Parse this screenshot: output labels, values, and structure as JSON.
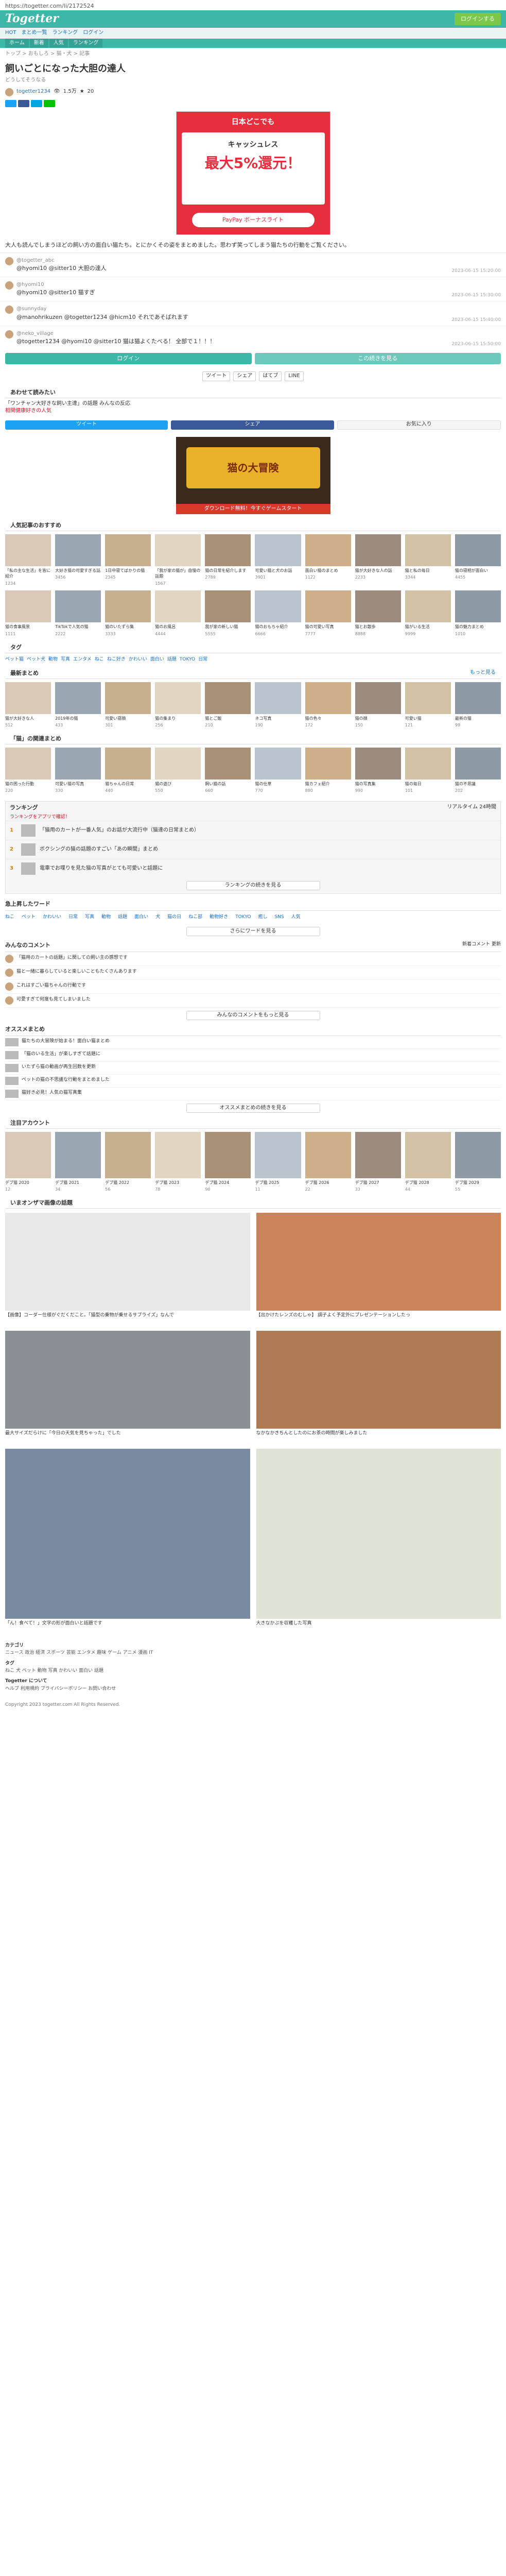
{
  "url": "https://togetter.com/li/2172524",
  "header": {
    "logo": "Togetter",
    "cta": "ログインする",
    "subnav": [
      "HOT",
      "まとめ一覧",
      "ランキング",
      "ログイン"
    ],
    "gnav": [
      "ホーム",
      "新着",
      "人気",
      "ランキング"
    ]
  },
  "breadcrumb": "トップ > おもしろ > 猫・犬 > 記事",
  "title": "飼いごとになった大胆の達人",
  "subtitle": "どうしてそうなる",
  "author": {
    "name": "togetter1234",
    "views": "1.5万",
    "favorites": "20"
  },
  "ad1": {
    "top": "日本どこでも",
    "mid": "キャッシュレス",
    "big": "最大5%還元！",
    "btn": "PayPay ボーナスライト"
  },
  "intro": "大人も読んでしまうほどの飼い方の面白い猫たち。とにかくその姿をまとめました。思わず笑ってしまう猫たちの行動をご覧ください。",
  "tweets": [
    {
      "user": "@togetter_abc",
      "text": "@hyomi10 @sitter10 大胆の達人",
      "time": "2023-06-15 15:20:00"
    },
    {
      "user": "@hyomi10",
      "text": "@hyomi10 @sitter10 猫すぎ",
      "time": "2023-06-15 15:30:00"
    },
    {
      "user": "@sunnyday",
      "text": "@manohrikuzen @togetter1234 @hicm10 それであそばれます",
      "time": "2023-06-15 15:40:00"
    },
    {
      "user": "@neko_village",
      "text": "@togetter1234 @hyomi10 @sitter10 猫は猫よくたべる！ 全部で１！！！",
      "time": "2023-06-15 15:50:00"
    }
  ],
  "pager": {
    "prev": "ログイン",
    "next": "この続きを見る"
  },
  "share": [
    "ツイート",
    "シェア",
    "はてブ",
    "LINE"
  ],
  "related": {
    "heading": "あわせて読みたい",
    "line1": "「ワンチャン大好きな飼い主達」の話題 みんなの反応",
    "line2": "相関健康好きの人気",
    "buttons": [
      "ツイート",
      "シェア",
      "お気に入り"
    ]
  },
  "ad2": {
    "text": "猫の大冒険",
    "bar": "ダウンロード無料！今すぐゲームスタート"
  },
  "section1": {
    "heading": "人気記事のおすすめ",
    "cards": [
      {
        "t": "「私の主な生活」を皆に紹介",
        "m": "1234"
      },
      {
        "t": "大好き猫の可愛すぎる話",
        "m": "3456"
      },
      {
        "t": "1日中寝てばかりの猫",
        "m": "2345"
      },
      {
        "t": "「我が家の猫が」自慢の話題",
        "m": "1567"
      },
      {
        "t": "猫の日常を紹介します",
        "m": "2789"
      },
      {
        "t": "可愛い猫と犬のお話",
        "m": "3901"
      },
      {
        "t": "面白い猫のまとめ",
        "m": "1122"
      },
      {
        "t": "猫が大好きな人の話",
        "m": "2233"
      },
      {
        "t": "猫と私の毎日",
        "m": "3344"
      },
      {
        "t": "猫の寝相が面白い",
        "m": "4455"
      },
      {
        "t": "猫の食事風景",
        "m": "1111"
      },
      {
        "t": "TikTokで人気の猫",
        "m": "2222"
      },
      {
        "t": "猫のいたずら集",
        "m": "3333"
      },
      {
        "t": "猫のお風呂",
        "m": "4444"
      },
      {
        "t": "我が家の新しい猫",
        "m": "5555"
      },
      {
        "t": "猫のおもちゃ紹介",
        "m": "6666"
      },
      {
        "t": "猫の可愛い写真",
        "m": "7777"
      },
      {
        "t": "猫とお散歩",
        "m": "8888"
      },
      {
        "t": "猫がいる生活",
        "m": "9999"
      },
      {
        "t": "猫の魅力まとめ",
        "m": "1010"
      }
    ]
  },
  "tags": [
    "ペット猫",
    "ペット犬",
    "動物",
    "写真",
    "エンタメ",
    "ねこ",
    "ねこ好き",
    "かわいい",
    "面白い",
    "話題",
    "TOKYO",
    "日常"
  ],
  "section2": {
    "heading": "最新まとめ",
    "more": "もっと見る",
    "cards": [
      {
        "t": "猫が大好きな人",
        "m": "512"
      },
      {
        "t": "2019年の猫",
        "m": "433"
      },
      {
        "t": "可愛い寝顔",
        "m": "301"
      },
      {
        "t": "猫の集まり",
        "m": "256"
      },
      {
        "t": "猫とご飯",
        "m": "210"
      },
      {
        "t": "ネコ写真",
        "m": "190"
      },
      {
        "t": "猫の色々",
        "m": "172"
      },
      {
        "t": "猫の顔",
        "m": "150"
      },
      {
        "t": "可愛い猫",
        "m": "121"
      },
      {
        "t": "最新の猫",
        "m": "99"
      }
    ]
  },
  "section3": {
    "heading": "「猫」の関連まとめ",
    "cards": [
      {
        "t": "猫の困った行動",
        "m": "220"
      },
      {
        "t": "可愛い猫の写真",
        "m": "330"
      },
      {
        "t": "猫ちゃんの日常",
        "m": "440"
      },
      {
        "t": "猫の遊び",
        "m": "550"
      },
      {
        "t": "飼い猫の話",
        "m": "660"
      },
      {
        "t": "猫の仕草",
        "m": "770"
      },
      {
        "t": "猫カフェ紹介",
        "m": "880"
      },
      {
        "t": "猫の写真集",
        "m": "990"
      },
      {
        "t": "猫の毎日",
        "m": "101"
      },
      {
        "t": "猫の不思議",
        "m": "202"
      }
    ]
  },
  "ranking": {
    "heading": "ランキング",
    "tabs": "リアルタイム  24時間",
    "sub": "ランキングをアプリで確認！",
    "items": [
      {
        "n": "1",
        "t": "「猫用のカートが一番人気」のお話が大流行中（猫達の日常まとめ）"
      },
      {
        "n": "2",
        "t": "ボクシングの猫の話題のすごい「あの瞬間」まとめ"
      },
      {
        "n": "3",
        "t": "電車でお喋りを見た猫の写真がとても可愛いと話題に"
      }
    ],
    "more": "ランキングの続きを見る"
  },
  "keywords": {
    "heading": "急上昇したワード",
    "list": [
      "ねこ",
      "ペット",
      "かわいい",
      "日常",
      "写真",
      "動物",
      "話題",
      "面白い",
      "犬",
      "猫の日",
      "ねこ部",
      "動物好き",
      "TOKYO",
      "癒し",
      "SNS",
      "人気"
    ],
    "more": "さらにワードを見る"
  },
  "comments": {
    "heading": "みんなのコメント",
    "tabs": "新着コメント  更新",
    "items": [
      "「猫用のカートの話題」に関しての飼い主の感想です",
      "猫と一緒に暮らしていると楽しいこともたくさんあります",
      "これはすごい猫ちゃんの行動です",
      "可愛すぎて何度も見てしまいました"
    ],
    "more": "みんなのコメントをもっと見る"
  },
  "recommend": {
    "heading": "オススメまとめ",
    "items": [
      "猫たちの大冒険が始まる！面白い猫まとめ",
      "「猫のいる生活」が楽しすぎて話題に",
      "いたずら猫の動画が再生回数を更新",
      "ペットの猫の不思議な行動をまとめました",
      "猫好き必見！人気の猫写真集"
    ],
    "more": "オススメまとめの続きを見る"
  },
  "pickup": {
    "heading": "注目アカウント",
    "cards": [
      {
        "t": "デブ猫 2020",
        "m": "12"
      },
      {
        "t": "デブ猫 2021",
        "m": "34"
      },
      {
        "t": "デブ猫 2022",
        "m": "56"
      },
      {
        "t": "デブ猫 2023",
        "m": "78"
      },
      {
        "t": "デブ猫 2024",
        "m": "90"
      },
      {
        "t": "デブ猫 2025",
        "m": "11"
      },
      {
        "t": "デブ猫 2026",
        "m": "22"
      },
      {
        "t": "デブ猫 2027",
        "m": "33"
      },
      {
        "t": "デブ猫 2028",
        "m": "44"
      },
      {
        "t": "デブ猫 2029",
        "m": "55"
      }
    ]
  },
  "photos": {
    "heading": "いまオンザマ画像の話題",
    "items": [
      {
        "c": "【画像】コーダー仕様がぐだくだこと。「猫型の乗物が乗せるサプライズ」なんで"
      },
      {
        "c": "【出かけたレンズのむしゃ】 調子よく予定外にプレゼンテーションしたっ"
      },
      {
        "c": "最大サイズだらけに「今日の天気を見ちゃった」でした"
      },
      {
        "c": "なかなかきちんとしたのにお茶の時間が楽しみました"
      },
      {
        "c": "「ん！食べて！」文字の形が面白いと話題です"
      },
      {
        "c": "大きなかぶを収穫した写真"
      }
    ]
  },
  "footer": {
    "h1": "カテゴリ",
    "l1": "ニュース 政治 経済 スポーツ 芸能 エンタメ 趣味 ゲーム アニメ 漫画 IT",
    "h2": "タグ",
    "l2": "ねこ 犬 ペット 動物 写真 かわいい 面白い 話題",
    "h3": "Togetter について",
    "l3": "ヘルプ 利用規約 プライバシーポリシー お問い合わせ",
    "copy": "Copyright 2023 togetter.com All Rights Reserved."
  }
}
